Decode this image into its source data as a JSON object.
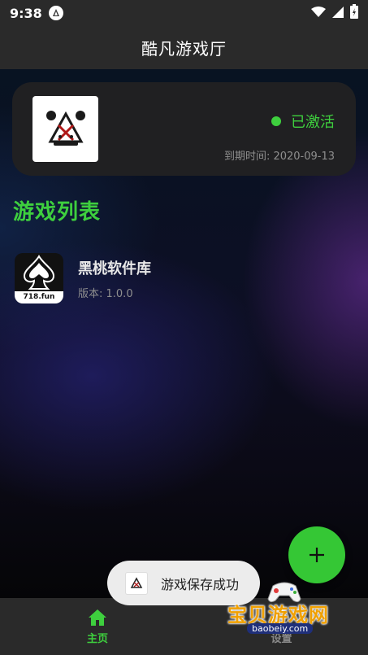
{
  "status_bar": {
    "time": "9:38"
  },
  "app_bar": {
    "title": "酷凡游戏厅"
  },
  "license": {
    "status": "已激活",
    "expiry": "到期时间: 2020-09-13"
  },
  "section": {
    "title": "游戏列表"
  },
  "games": [
    {
      "name": "黑桃软件库",
      "version": "版本: 1.0.0",
      "badge": "718.fun"
    }
  ],
  "toast": {
    "message": "游戏保存成功"
  },
  "nav": {
    "home_label": "主页",
    "settings_label": "设置"
  },
  "watermark": {
    "text": "宝贝游戏网",
    "url": "baobeiy.com"
  },
  "colors": {
    "accent": "#3ecf3e",
    "fab": "#35c735",
    "bar": "#2a2a2a",
    "card": "#202022"
  }
}
